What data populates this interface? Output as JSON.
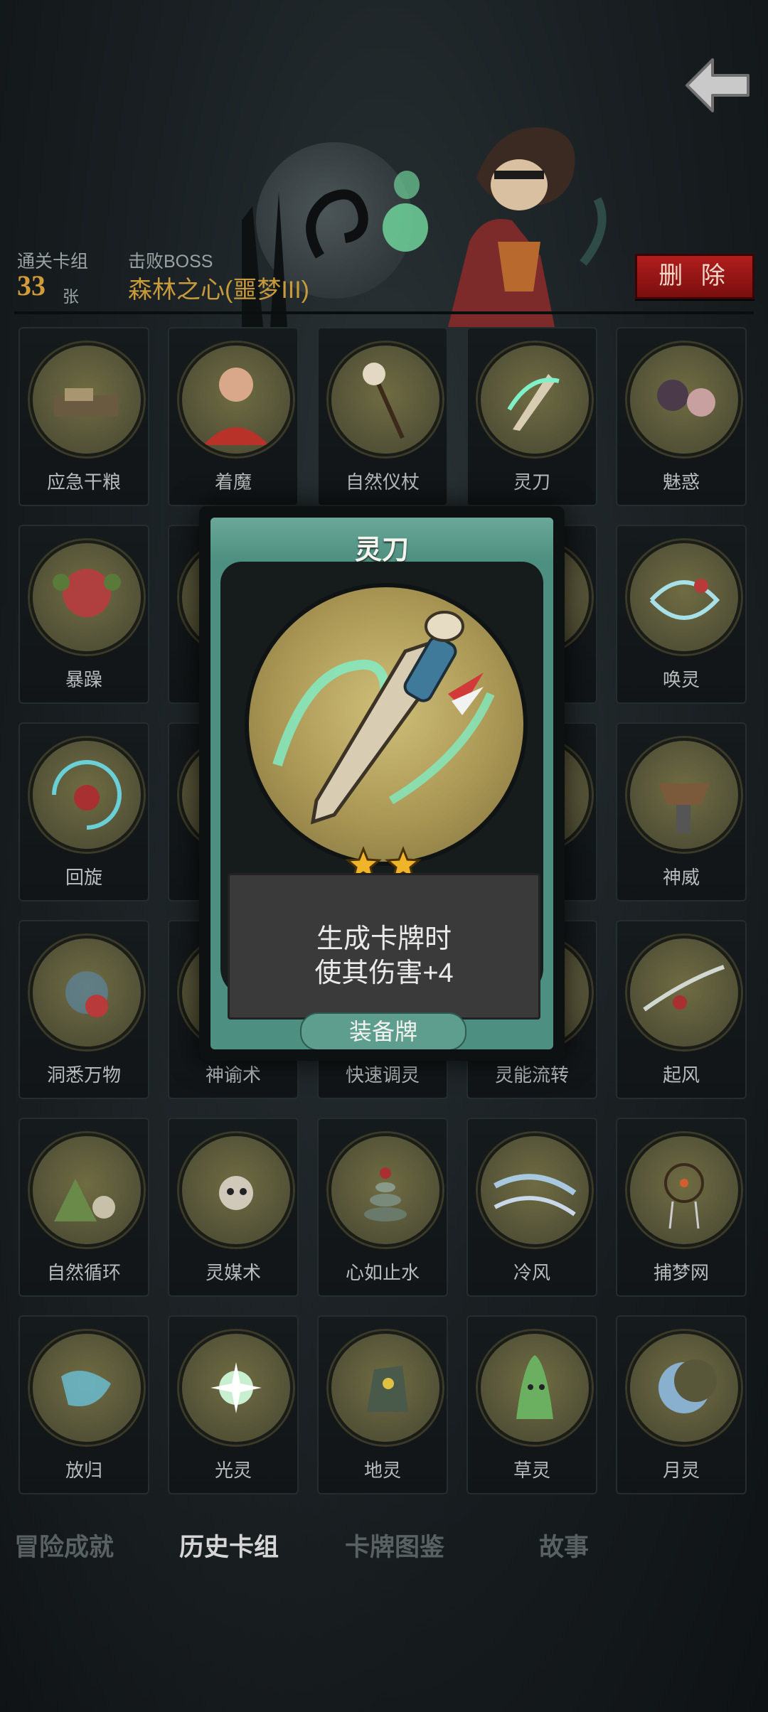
{
  "header": {
    "deck_label": "通关卡组",
    "deck_count": "33",
    "deck_unit": "张",
    "boss_label": "击败BOSS",
    "boss_name": "森林之心(噩梦III)",
    "delete_label": "删 除"
  },
  "cards": [
    {
      "name": "应急干粮",
      "icon": "food-pile-icon"
    },
    {
      "name": "着魔",
      "icon": "possessed-man-icon"
    },
    {
      "name": "自然仪杖",
      "icon": "nature-staff-icon"
    },
    {
      "name": "灵刀",
      "icon": "spirit-blade-icon"
    },
    {
      "name": "魅惑",
      "icon": "charm-icon"
    },
    {
      "name": "暴躁",
      "icon": "rage-ogre-icon"
    },
    {
      "name": "",
      "icon": "hidden-card-icon"
    },
    {
      "name": "",
      "icon": "hidden-card-icon"
    },
    {
      "name": "",
      "icon": "hidden-card-icon"
    },
    {
      "name": "唤灵",
      "icon": "summon-spirit-icon"
    },
    {
      "name": "回旋",
      "icon": "whirl-icon"
    },
    {
      "name": "",
      "icon": "hidden-card-icon"
    },
    {
      "name": "",
      "icon": "hidden-card-icon"
    },
    {
      "name": "",
      "icon": "hidden-card-icon"
    },
    {
      "name": "神威",
      "icon": "divine-might-icon"
    },
    {
      "name": "洞悉万物",
      "icon": "insight-icon"
    },
    {
      "name": "神谕术",
      "icon": "oracle-icon"
    },
    {
      "name": "快速调灵",
      "icon": "quick-tune-icon"
    },
    {
      "name": "灵能流转",
      "icon": "psi-flow-icon"
    },
    {
      "name": "起风",
      "icon": "wind-rise-icon"
    },
    {
      "name": "自然循环",
      "icon": "nature-cycle-icon"
    },
    {
      "name": "灵媒术",
      "icon": "medium-skull-icon"
    },
    {
      "name": "心如止水",
      "icon": "stone-stack-icon"
    },
    {
      "name": "冷风",
      "icon": "cold-wind-icon"
    },
    {
      "name": "捕梦网",
      "icon": "dreamcatcher-icon"
    },
    {
      "name": "放归",
      "icon": "release-spirit-icon"
    },
    {
      "name": "光灵",
      "icon": "light-spirit-icon"
    },
    {
      "name": "地灵",
      "icon": "earth-spirit-icon"
    },
    {
      "name": "草灵",
      "icon": "grass-spirit-icon"
    },
    {
      "name": "月灵",
      "icon": "moon-spirit-icon"
    }
  ],
  "popup": {
    "title": "灵刀",
    "stars": 2,
    "desc_line1": "生成卡牌时",
    "desc_line2": "使其伤害+4",
    "type": "装备牌",
    "colors": {
      "face": "#4d8f80",
      "star": "#f0b429"
    }
  },
  "tabs": [
    {
      "label": "冒险成就",
      "active": false
    },
    {
      "label": "历史卡组",
      "active": true
    },
    {
      "label": "卡牌图鉴",
      "active": false
    },
    {
      "label": "故事",
      "active": false
    }
  ]
}
